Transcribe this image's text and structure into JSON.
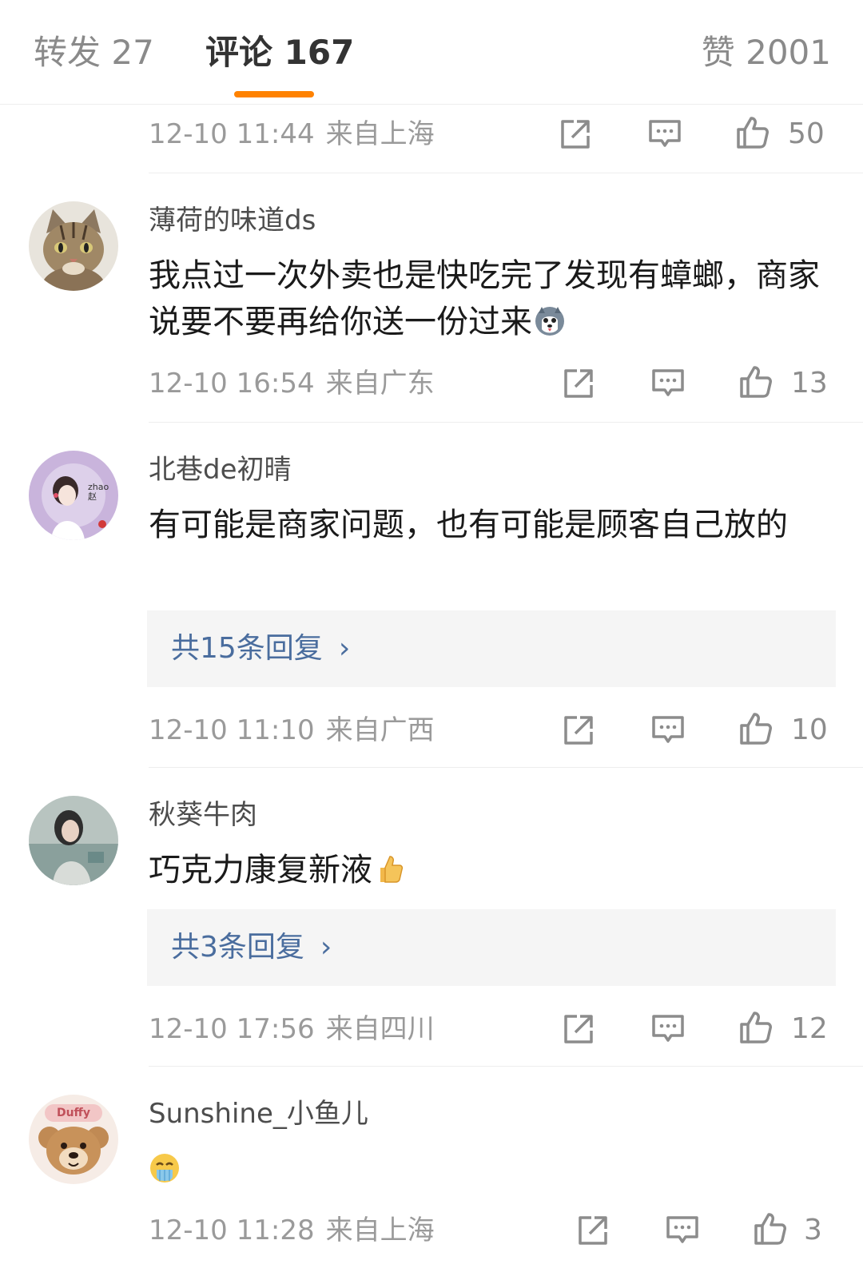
{
  "tabs": {
    "repost": "转发 27",
    "comments": "评论 167",
    "likes": "赞 2001"
  },
  "colors": {
    "accent": "#ff8200",
    "link": "#4a6d9e",
    "meta": "#9a9a9a",
    "reply_bg": "#f5f5f5"
  },
  "top_item": {
    "time": "12-10 11:44",
    "location": "来自上海",
    "likes": "50"
  },
  "comments": [
    {
      "username": "薄荷的味道ds",
      "avatar": "tabby-cat-avatar",
      "text": "我点过一次外卖也是快吃完了发现有蟑螂，商家说要不要再给你送一份过来",
      "emoji": "husky-dog-emoji",
      "time": "12-10 16:54",
      "location": "来自广东",
      "likes": "13"
    },
    {
      "username": "北巷de初晴",
      "avatar": "anime-girl-avatar",
      "avatar_text": "zhao 赵",
      "text": "有可能是商家问题，也有可能是顾客自己放的",
      "replies": "共15条回复",
      "time": "12-10 11:10",
      "location": "来自广西",
      "likes": "10"
    },
    {
      "username": "秋葵牛肉",
      "avatar": "portrait-photo-avatar",
      "text": "巧克力康复新液",
      "emoji": "thumbs-up-emoji",
      "replies": "共3条回复",
      "time": "12-10 17:56",
      "location": "来自四川",
      "likes": "12"
    },
    {
      "username": "Sunshine_小鱼儿",
      "avatar": "duffy-bear-avatar",
      "avatar_text": "Duffy",
      "text": "",
      "emoji": "crying-emoji",
      "time": "12-10 11:28",
      "location": "来自上海",
      "likes": "3"
    }
  ]
}
